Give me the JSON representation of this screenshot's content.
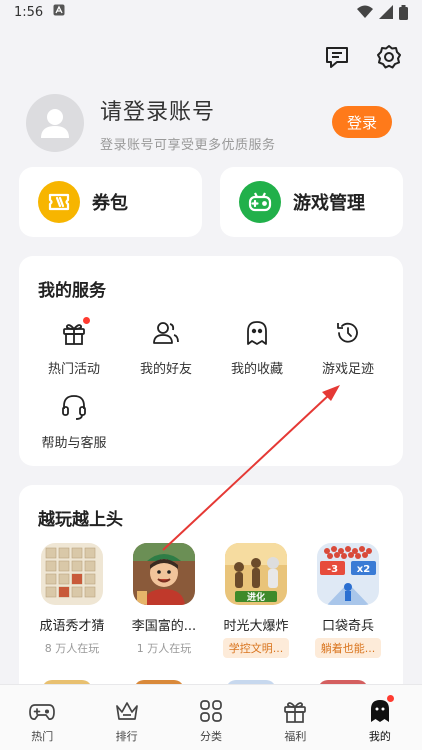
{
  "status_bar": {
    "time": "1:56",
    "notification_icon": "a-badge-icon"
  },
  "header": {
    "message_icon": "chat-icon",
    "settings_icon": "gear-icon"
  },
  "profile": {
    "title": "请登录账号",
    "subtitle": "登录账号可享受更多优质服务",
    "login_label": "登录"
  },
  "quick_cards": [
    {
      "label": "券包",
      "icon": "ticket-icon",
      "color": "#f7b500"
    },
    {
      "label": "游戏管理",
      "icon": "gamepad-icon",
      "color": "#21b04a"
    }
  ],
  "services": {
    "title": "我的服务",
    "items": [
      {
        "label": "热门活动",
        "icon": "gift-icon",
        "has_dot": true
      },
      {
        "label": "我的好友",
        "icon": "friends-icon",
        "has_dot": false
      },
      {
        "label": "我的收藏",
        "icon": "ghost-icon",
        "has_dot": false
      },
      {
        "label": "游戏足迹",
        "icon": "history-icon",
        "has_dot": false
      },
      {
        "label": "帮助与客服",
        "icon": "headset-icon",
        "has_dot": false
      }
    ]
  },
  "games": {
    "title": "越玩越上头",
    "items": [
      {
        "name": "成语秀才猜",
        "meta": "8 万人在玩"
      },
      {
        "name": "李国富的...",
        "meta": "1 万人在玩"
      },
      {
        "name": "时光大爆炸",
        "tag": "学控文明..."
      },
      {
        "name": "口袋奇兵",
        "tag": "躺着也能..."
      }
    ],
    "icon_texts": {
      "evolve": "进化",
      "minus3": "-3",
      "x2": "x2"
    }
  },
  "bottom_nav": [
    {
      "label": "热门",
      "icon": "gamepad-nav-icon"
    },
    {
      "label": "排行",
      "icon": "crown-icon"
    },
    {
      "label": "分类",
      "icon": "grid-icon"
    },
    {
      "label": "福利",
      "icon": "gift-nav-icon"
    },
    {
      "label": "我的",
      "icon": "ghost-nav-icon",
      "active": true
    }
  ],
  "colors": {
    "accent": "#ff7a1a",
    "dot": "#ff3b30",
    "annotation": "#e53935"
  }
}
